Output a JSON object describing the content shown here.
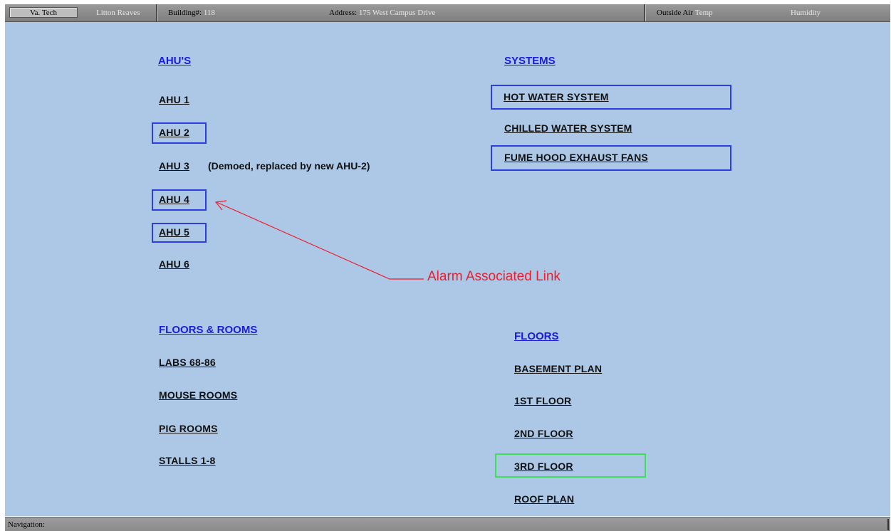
{
  "header": {
    "site": "Va. Tech",
    "building_name": "Litton Reaves",
    "building_num_label": "Building#:",
    "building_num_value": "118",
    "address_label": "Address:",
    "address_value": "175 West Campus Drive",
    "outside_air_label": "Outside Air",
    "temp_label": "Temp",
    "humidity_label": "Humidity"
  },
  "ahus": {
    "heading": "AHU'S",
    "items": [
      {
        "label": "AHU 1 ",
        "alarm": false
      },
      {
        "label": "AHU 2",
        "alarm": true
      },
      {
        "label": "AHU 3",
        "alarm": false,
        "note": "(Demoed, replaced by new AHU-2)"
      },
      {
        "label": "AHU 4",
        "alarm": true
      },
      {
        "label": "AHU 5",
        "alarm": true
      },
      {
        "label": "AHU 6",
        "alarm": false
      }
    ]
  },
  "systems": {
    "heading": "SYSTEMS",
    "items": [
      {
        "label": "HOT WATER SYSTEM",
        "alarm": true
      },
      {
        "label": "CHILLED WATER SYSTEM",
        "alarm": false
      },
      {
        "label": "FUME HOOD EXHAUST FANS",
        "alarm": true
      }
    ]
  },
  "floors_rooms": {
    "heading": "FLOORS & ROOMS",
    "items": [
      {
        "label": "LABS 68-86"
      },
      {
        "label": "MOUSE ROOMS"
      },
      {
        "label": "PIG ROOMS"
      },
      {
        "label": "STALLS 1-8"
      }
    ]
  },
  "floors": {
    "heading": "FLOORS",
    "items": [
      {
        "label": "BASEMENT PLAN",
        "highlight": false
      },
      {
        "label": "1ST FLOOR",
        "highlight": false
      },
      {
        "label": "2ND FLOOR",
        "highlight": false
      },
      {
        "label": "3RD FLOOR",
        "highlight": true
      },
      {
        "label": "ROOF PLAN",
        "highlight": false
      }
    ]
  },
  "annotation": {
    "text": "Alarm Associated Link",
    "color": "#ee1c2c"
  },
  "navbar": {
    "label": "Navigation:"
  },
  "colors": {
    "background": "#adc8e6",
    "heading_link": "#1c1cd6",
    "alarm_box": "#2b3fe0",
    "highlight_box": "#3ee05a"
  }
}
